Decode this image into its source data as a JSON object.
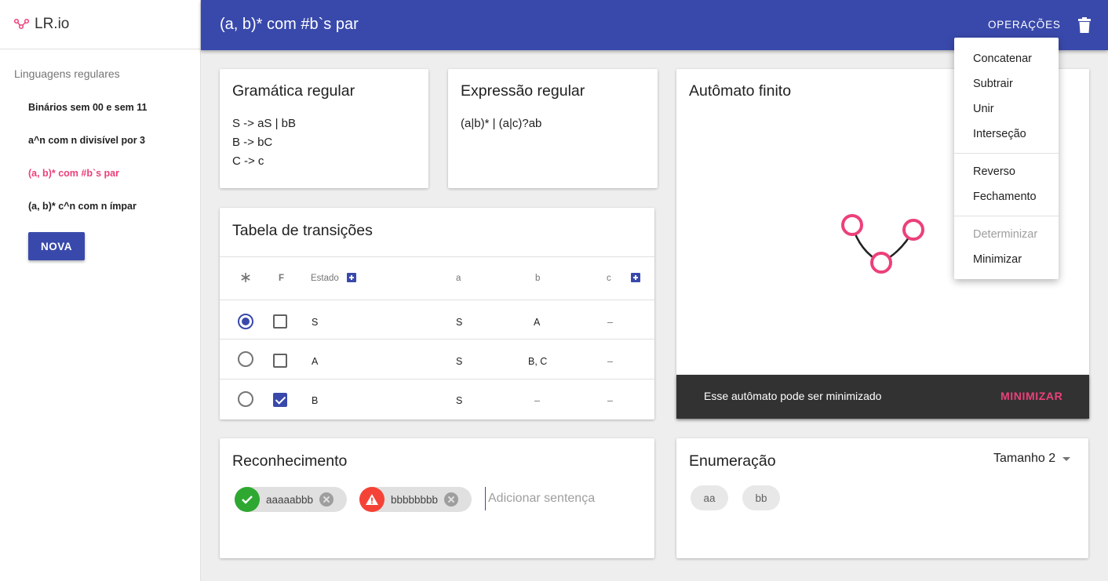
{
  "sidebar": {
    "brand": "LR.io",
    "subtitle": "Linguagens regulares",
    "items": [
      {
        "label": "Binários sem 00 e sem 11"
      },
      {
        "label": "a^n com n divisível por 3"
      },
      {
        "label": "(a, b)* com #b`s par"
      },
      {
        "label": "(a, b)* c^n com n ímpar"
      }
    ],
    "new_button": "NOVA"
  },
  "topbar": {
    "title": "(a, b)* com #b`s par",
    "operations": "OPERAÇÕES"
  },
  "grammar": {
    "title": "Gramática regular",
    "lines": [
      "S -> aS | bB",
      "B -> bC",
      "C -> c"
    ]
  },
  "regex": {
    "title": "Expressão regular",
    "value": "(a|b)* | (a|c)?ab"
  },
  "automaton": {
    "title": "Autômato finito",
    "snackbar_text": "Esse autômato pode ser minimizado",
    "snackbar_action": "MINIMIZAR",
    "colors": {
      "state": "#ec407a",
      "edge": "#212121"
    }
  },
  "table": {
    "title": "Tabela de transições",
    "headers": {
      "initial": "*",
      "final": "F",
      "state": "Estado",
      "symbols": [
        "a",
        "b",
        "c"
      ]
    },
    "rows": [
      {
        "state": "S",
        "initial": true,
        "final": false,
        "cells": [
          "S",
          "A",
          "–"
        ]
      },
      {
        "state": "A",
        "initial": false,
        "final": false,
        "cells": [
          "S",
          "B, C",
          "–"
        ]
      },
      {
        "state": "B",
        "initial": false,
        "final": true,
        "cells": [
          "S",
          "–",
          "–"
        ]
      }
    ]
  },
  "recognition": {
    "title": "Reconhecimento",
    "chips": [
      {
        "text": "aaaaabbb",
        "status": "accepted",
        "icon": "check-icon"
      },
      {
        "text": "bbbbbbbb",
        "status": "rejected",
        "icon": "warning-icon"
      }
    ],
    "placeholder": "Adicionar sentença"
  },
  "enumeration": {
    "title": "Enumeração",
    "size_label": "Tamanho 2",
    "words": [
      "aa",
      "bb"
    ]
  },
  "menu": {
    "groups": [
      [
        "Concatenar",
        "Subtrair",
        "Unir",
        "Interseção"
      ],
      [
        "Reverso",
        "Fechamento"
      ],
      [
        "Determinizar",
        "Minimizar"
      ]
    ],
    "disabled": [
      "Determinizar"
    ]
  },
  "colors": {
    "primary": "#3949ab",
    "accent": "#ec407a",
    "success": "#2ea831",
    "error": "#f44336"
  }
}
